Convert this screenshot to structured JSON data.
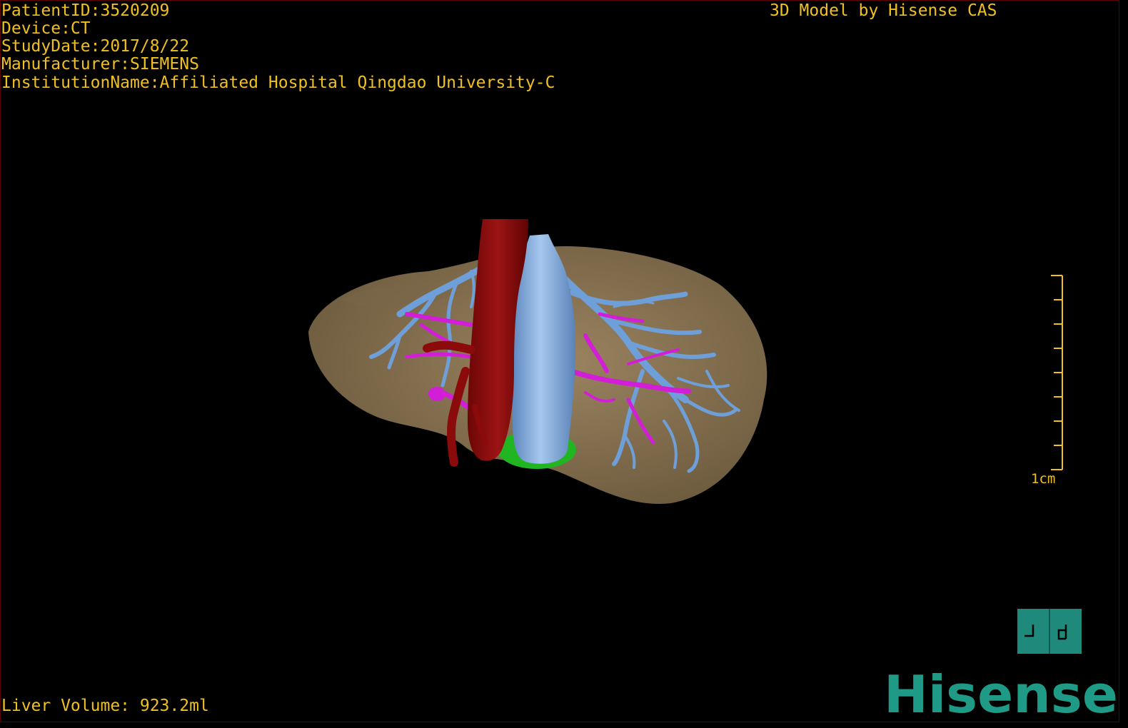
{
  "overlay": {
    "patient_id": "PatientID:3520209",
    "device": "Device:CT",
    "study_date": "StudyDate:2017/8/22",
    "manufacturer": "Manufacturer:SIEMENS",
    "institution": "InstitutionName:Affiliated Hospital Qingdao University-C",
    "credit": "3D Model by Hisense CAS",
    "liver_volume": "Liver Volume: 923.2ml"
  },
  "scale_bar": {
    "label": "1cm"
  },
  "brand": {
    "text": "Hisense",
    "color": "#1f9a86"
  },
  "colors": {
    "overlay_text": "#f0c020",
    "liver": "#8a7452",
    "vena_cava": "#7ea8dc",
    "portal_branches": "#6f9fd8",
    "aorta": "#8b0a0a",
    "hepatic_artery": "#d21ed6",
    "gallbladder": "#22b522",
    "orientation_cube": "#1f8a7c"
  },
  "model": {
    "structures": [
      "liver",
      "inferior-vena-cava",
      "portal-vein",
      "aorta",
      "hepatic-artery",
      "gallbladder"
    ]
  }
}
